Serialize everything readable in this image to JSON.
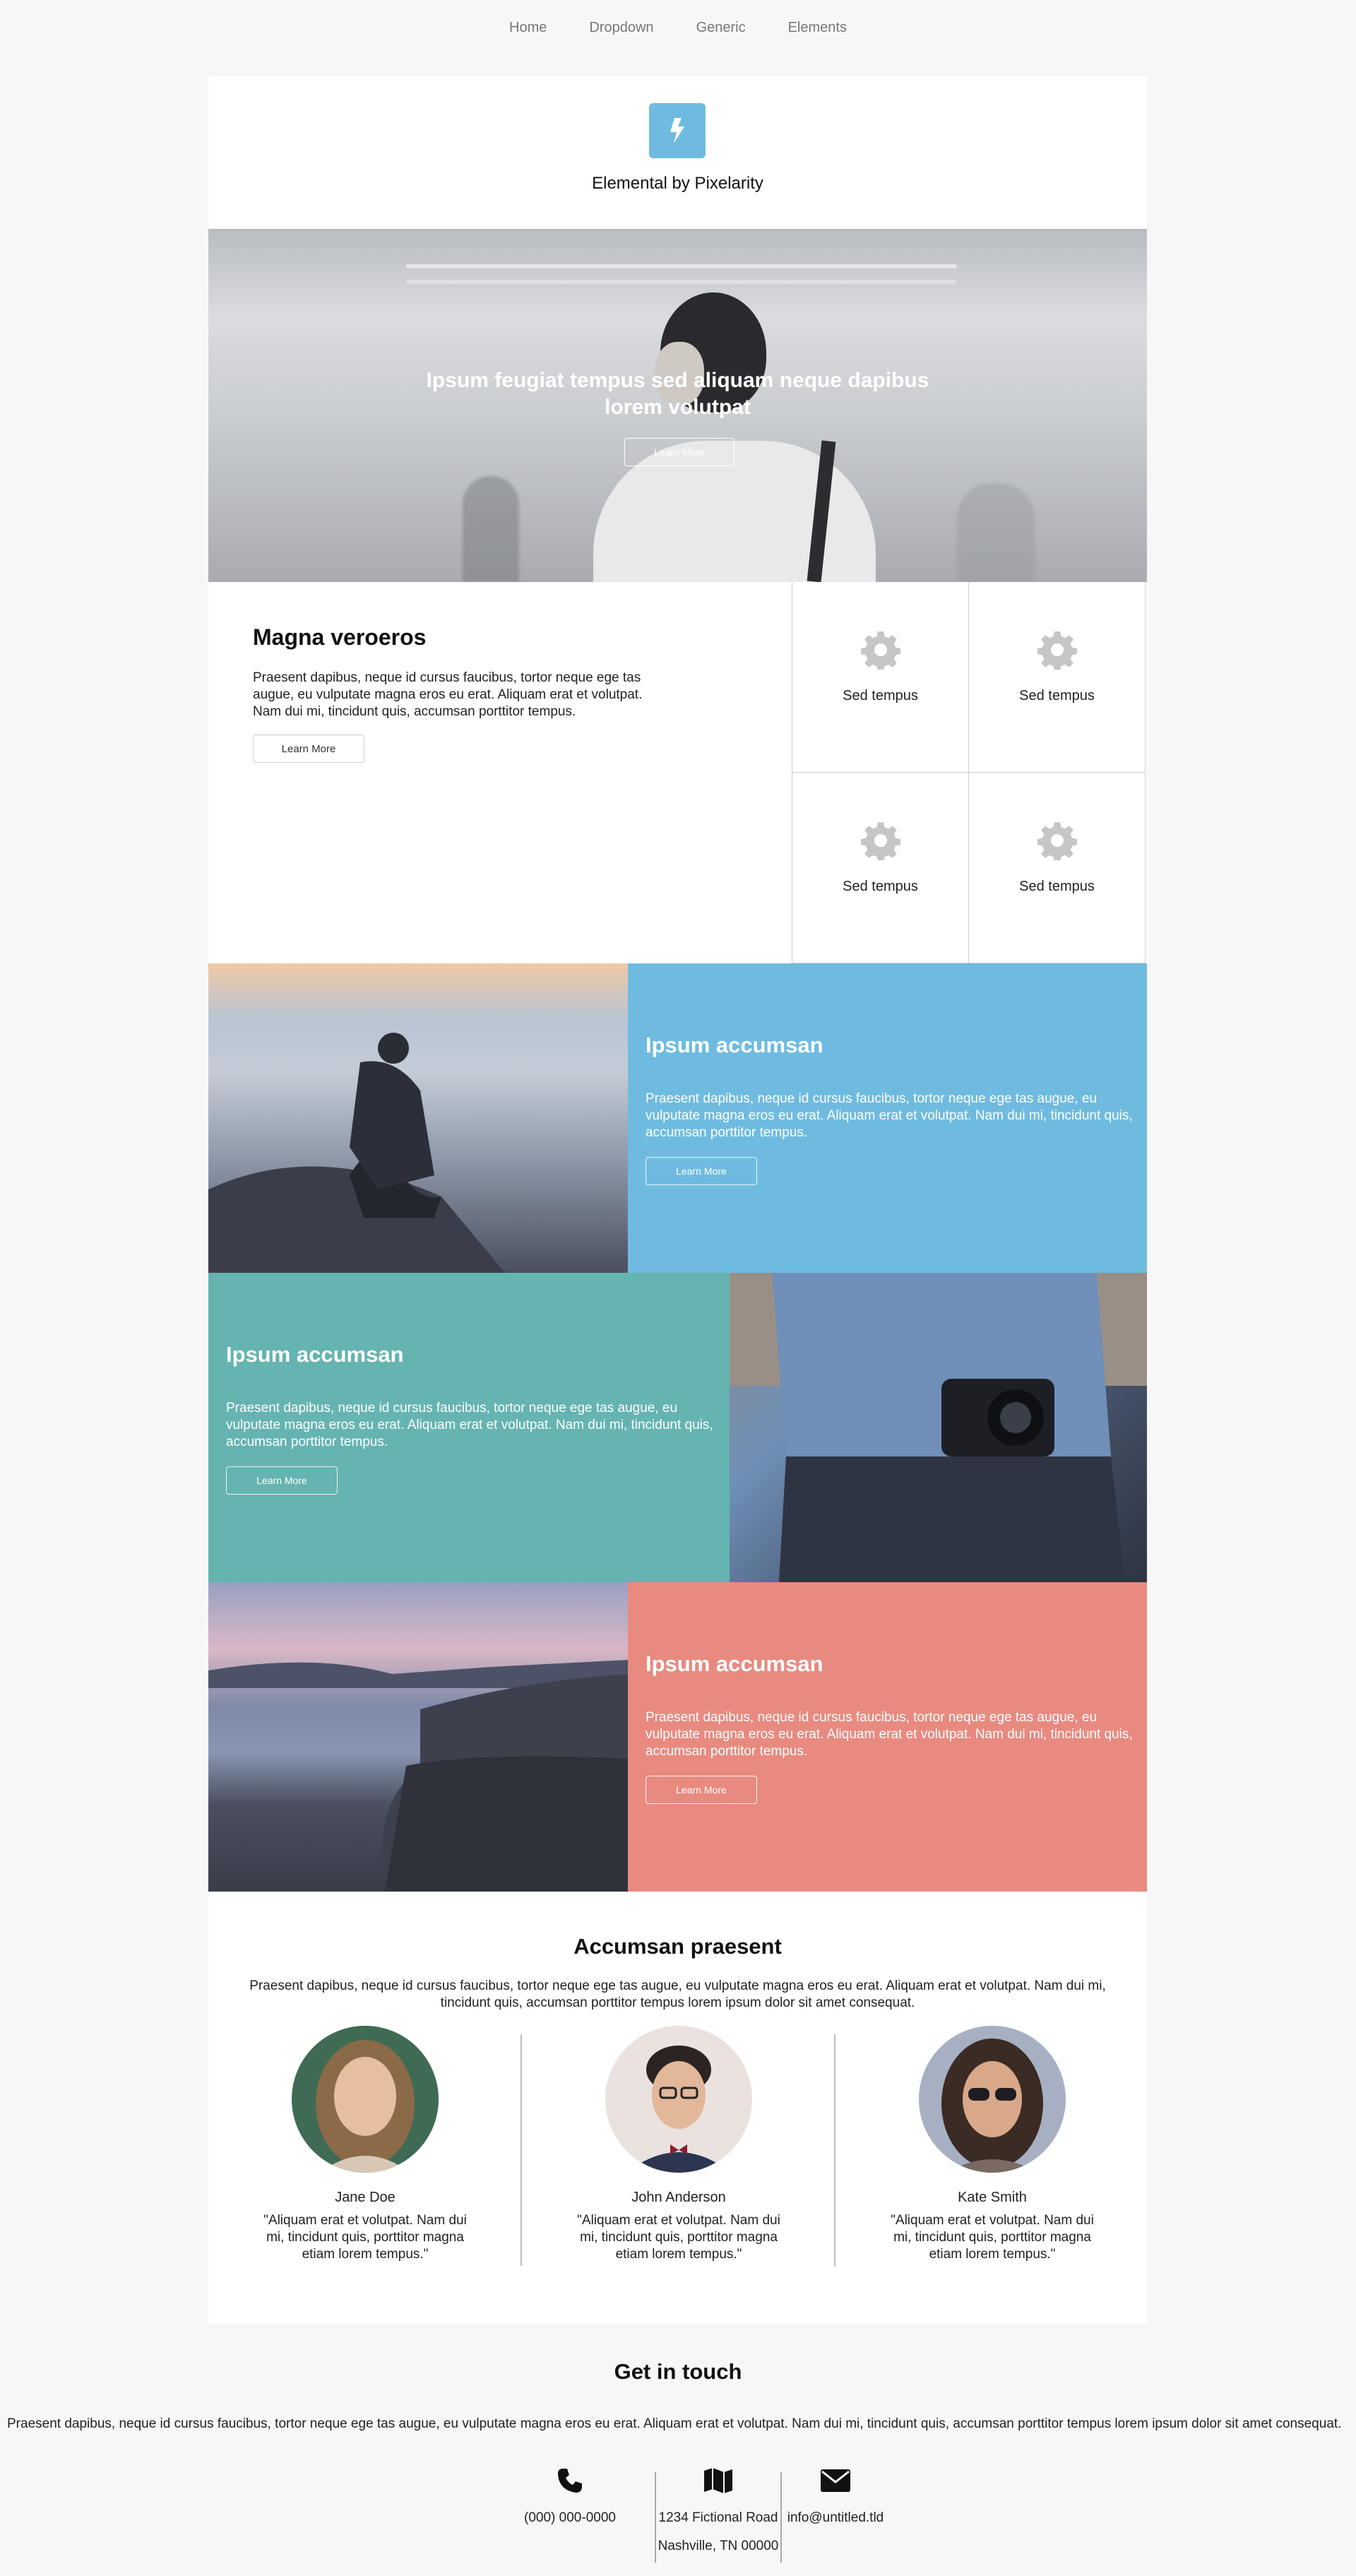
{
  "nav": {
    "items": [
      "Home",
      "Dropdown",
      "Generic",
      "Elements"
    ]
  },
  "header": {
    "logo_icon": "bolt-icon",
    "title": "Elemental by Pixelarity",
    "accent": "#6fbbe0"
  },
  "banner": {
    "title": "Ipsum feugiat tempus sed aliquam neque dapibus lorem volutpat",
    "button": "Learn More"
  },
  "intro": {
    "title": "Magna veroeros",
    "text": "Praesent dapibus, neque id cursus faucibus, tortor neque ege tas augue, eu vulputate magna eros eu erat. Aliquam erat et volutpat. Nam dui mi, tincidunt quis, accumsan porttitor tempus.",
    "button": "Learn More",
    "features": [
      {
        "icon": "gear-icon",
        "label": "Sed tempus"
      },
      {
        "icon": "gear-icon",
        "label": "Sed tempus"
      },
      {
        "icon": "gear-icon",
        "label": "Sed tempus"
      },
      {
        "icon": "gear-icon",
        "label": "Sed tempus"
      }
    ]
  },
  "spotlights": [
    {
      "title": "Ipsum accumsan",
      "text": "Praesent dapibus, neque id cursus faucibus, tortor neque ege tas augue, eu vulputate magna eros eu erat. Aliquam erat et volutpat. Nam dui mi, tincidunt quis, accumsan porttitor tempus.",
      "button": "Learn More",
      "color": "#6fbbe0"
    },
    {
      "title": "Ipsum accumsan",
      "text": "Praesent dapibus, neque id cursus faucibus, tortor neque ege tas augue, eu vulputate magna eros eu erat. Aliquam erat et volutpat. Nam dui mi, tincidunt quis, accumsan porttitor tempus.",
      "button": "Learn More",
      "color": "#65b4b1"
    },
    {
      "title": "Ipsum accumsan",
      "text": "Praesent dapibus, neque id cursus faucibus, tortor neque ege tas augue, eu vulputate magna eros eu erat. Aliquam erat et volutpat. Nam dui mi, tincidunt quis, accumsan porttitor tempus.",
      "button": "Learn More",
      "color": "#e88a80"
    }
  ],
  "team": {
    "title": "Accumsan praesent",
    "intro": "Praesent dapibus, neque id cursus faucibus, tortor neque ege tas augue, eu vulputate magna eros eu erat. Aliquam erat et volutpat. Nam dui mi, tincidunt quis, accumsan porttitor tempus lorem ipsum dolor sit amet consequat.",
    "members": [
      {
        "name": "Jane Doe",
        "quote": "\"Aliquam erat et volutpat. Nam dui mi, tincidunt quis, porttitor magna etiam lorem tempus.\""
      },
      {
        "name": "John Anderson",
        "quote": "\"Aliquam erat et volutpat. Nam dui mi, tincidunt quis, porttitor magna etiam lorem tempus.\""
      },
      {
        "name": "Kate Smith",
        "quote": "\"Aliquam erat et volutpat. Nam dui mi, tincidunt quis, porttitor magna etiam lorem tempus.\""
      }
    ]
  },
  "contact": {
    "title": "Get in touch",
    "text": "Praesent dapibus, neque id cursus faucibus, tortor neque ege tas augue, eu vulputate magna eros eu erat. Aliquam erat et volutpat. Nam dui mi, tincidunt quis, accumsan porttitor tempus lorem ipsum dolor sit amet consequat.",
    "phone": {
      "icon": "phone-icon",
      "value": "(000) 000-0000"
    },
    "address": {
      "icon": "map-icon",
      "line1": "1234 Fictional Road",
      "line2": "Nashville, TN 00000"
    },
    "email": {
      "icon": "envelope-icon",
      "value": "info@untitled.tld"
    }
  }
}
